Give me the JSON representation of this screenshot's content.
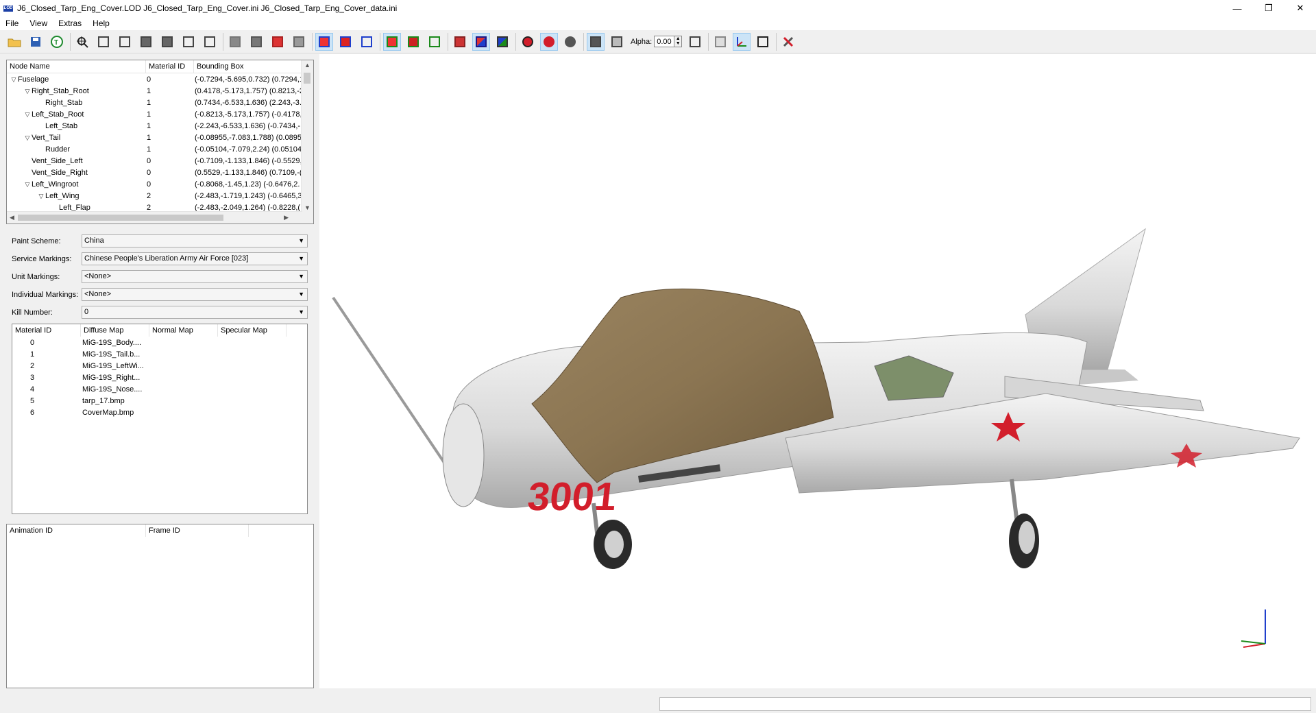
{
  "window": {
    "title": "J6_Closed_Tarp_Eng_Cover.LOD  J6_Closed_Tarp_Eng_Cover.ini  J6_Closed_Tarp_Eng_Cover_data.ini",
    "app_badge": "LOD",
    "minimize": "—",
    "maximize": "❐",
    "close": "✕"
  },
  "menu": [
    "File",
    "View",
    "Extras",
    "Help"
  ],
  "toolbar": {
    "alpha_label": "Alpha:",
    "alpha_value": "0.00"
  },
  "node_tree": {
    "columns": [
      "Node Name",
      "Material ID",
      "Bounding Box"
    ],
    "rows": [
      {
        "name": "Fuselage",
        "material": "0",
        "bbox": "(-0.7294,-5.695,0.732) (0.7294,1.",
        "depth": 0,
        "expanded": true
      },
      {
        "name": "Right_Stab_Root",
        "material": "1",
        "bbox": "(0.4178,-5.173,1.757) (0.8213,-2.",
        "depth": 1,
        "expanded": true
      },
      {
        "name": "Right_Stab",
        "material": "1",
        "bbox": "(0.7434,-6.533,1.636) (2.243,-3.",
        "depth": 2,
        "expanded": null
      },
      {
        "name": "Left_Stab_Root",
        "material": "1",
        "bbox": "(-0.8213,-5.173,1.757) (-0.4178,",
        "depth": 1,
        "expanded": true
      },
      {
        "name": "Left_Stab",
        "material": "1",
        "bbox": "(-2.243,-6.533,1.636) (-0.7434,-",
        "depth": 2,
        "expanded": null
      },
      {
        "name": "Vert_Tail",
        "material": "1",
        "bbox": "(-0.08955,-7.083,1.788) (0.0895",
        "depth": 1,
        "expanded": true
      },
      {
        "name": "Rudder",
        "material": "1",
        "bbox": "(-0.05104,-7.079,2.24) (0.05104",
        "depth": 2,
        "expanded": null
      },
      {
        "name": "Vent_Side_Left",
        "material": "0",
        "bbox": "(-0.7109,-1.133,1.846) (-0.5529,",
        "depth": 1,
        "expanded": null
      },
      {
        "name": "Vent_Side_Right",
        "material": "0",
        "bbox": "(0.5529,-1.133,1.846) (0.7109,-(",
        "depth": 1,
        "expanded": null
      },
      {
        "name": "Left_Wingroot",
        "material": "0",
        "bbox": "(-0.8068,-1.45,1.23) (-0.6476,2.",
        "depth": 1,
        "expanded": true
      },
      {
        "name": "Left_Wing",
        "material": "2",
        "bbox": "(-2.483,-1.719,1.243) (-0.6465,3.",
        "depth": 2,
        "expanded": true
      },
      {
        "name": "Left_Flap",
        "material": "2",
        "bbox": "(-2.483,-2.049,1.264) (-0.8228,(",
        "depth": 3,
        "expanded": null
      }
    ]
  },
  "markings": {
    "paint_scheme": {
      "label": "Paint Scheme:",
      "value": "China"
    },
    "service_markings": {
      "label": "Service Markings:",
      "value": "Chinese People's Liberation Army Air Force [023]"
    },
    "unit_markings": {
      "label": "Unit Markings:",
      "value": "<None>"
    },
    "individual_markings": {
      "label": "Individual Markings:",
      "value": "<None>"
    },
    "kill_number": {
      "label": "Kill Number:",
      "value": "0"
    }
  },
  "materials": {
    "columns": [
      "Material ID",
      "Diffuse Map",
      "Normal Map",
      "Specular Map"
    ],
    "rows": [
      {
        "id": "0",
        "diffuse": "MiG-19S_Body...."
      },
      {
        "id": "1",
        "diffuse": "MiG-19S_Tail.b..."
      },
      {
        "id": "2",
        "diffuse": "MiG-19S_LeftWi..."
      },
      {
        "id": "3",
        "diffuse": "MiG-19S_Right..."
      },
      {
        "id": "4",
        "diffuse": "MiG-19S_Nose...."
      },
      {
        "id": "5",
        "diffuse": "tarp_17.bmp"
      },
      {
        "id": "6",
        "diffuse": "CoverMap.bmp"
      }
    ]
  },
  "animations": {
    "columns": [
      "Animation ID",
      "Frame ID"
    ]
  },
  "model": {
    "nose_number": "3001"
  },
  "colors": {
    "accent_blue": "#1f3fcc",
    "toolbar_active": "#cce4f7",
    "marking_red": "#d21e2b",
    "tarp_brown": "#8b7552"
  }
}
